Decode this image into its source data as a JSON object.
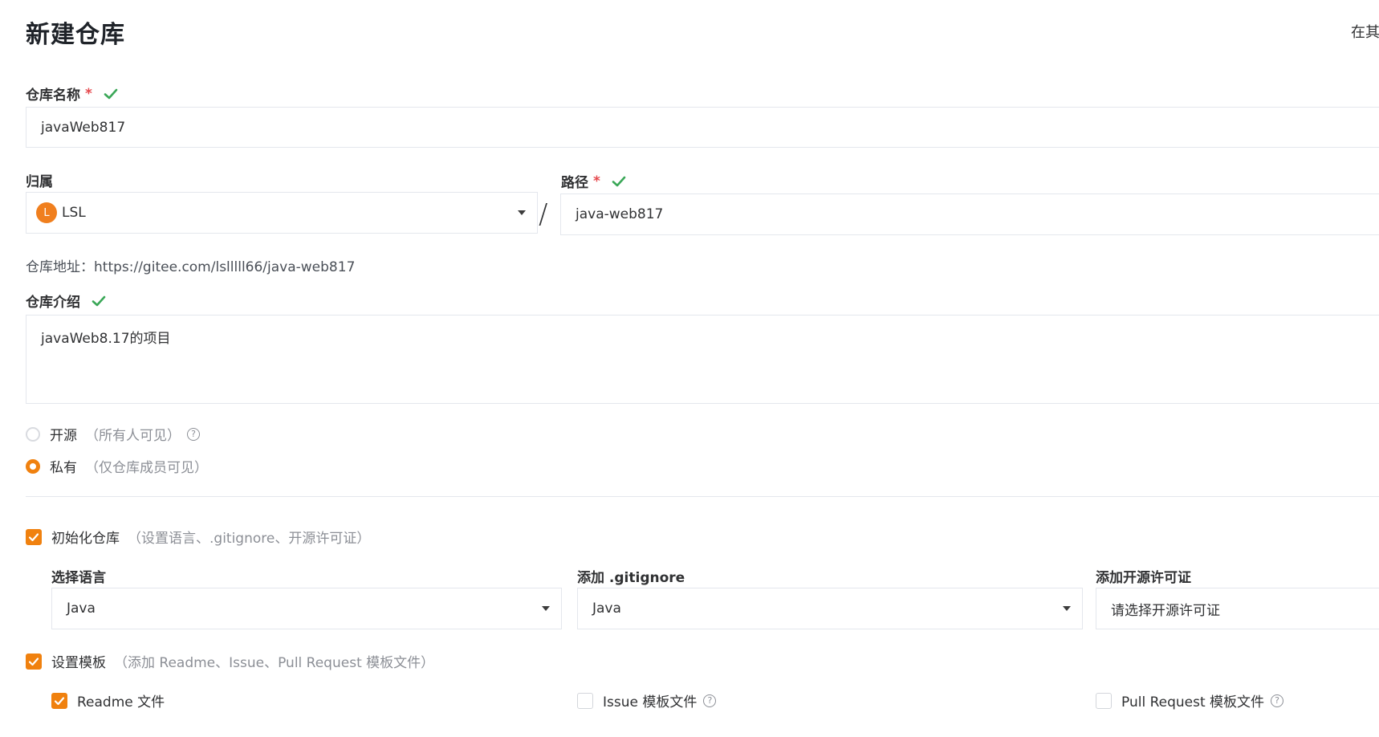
{
  "page": {
    "title": "新建仓库",
    "top_right_partial": "在其"
  },
  "repo_name": {
    "label": "仓库名称",
    "required_mark": "*",
    "value": "javaWeb817"
  },
  "owner": {
    "label": "归属",
    "avatar_letter": "L",
    "value": "LSL",
    "avatar_color": "#f07f1e"
  },
  "path": {
    "label": "路径",
    "required_mark": "*",
    "separator": "/",
    "value": "java-web817"
  },
  "repo_url": {
    "label": "仓库地址：",
    "value": "https://gitee.com/lslllll66/java-web817"
  },
  "description": {
    "label": "仓库介绍",
    "value": "javaWeb8.17的项目"
  },
  "visibility": {
    "public": {
      "label": "开源",
      "hint": "（所有人可见）",
      "selected": false
    },
    "private": {
      "label": "私有",
      "hint": "（仅仓库成员可见）",
      "selected": true
    }
  },
  "init": {
    "label": "初始化仓库",
    "hint": "（设置语言、.gitignore、开源许可证）",
    "checked": true,
    "language": {
      "label": "选择语言",
      "value": "Java"
    },
    "gitignore": {
      "label": "添加 .gitignore",
      "value": "Java"
    },
    "license": {
      "label": "添加开源许可证",
      "placeholder": "请选择开源许可证"
    }
  },
  "template": {
    "label": "设置模板",
    "hint": "（添加 Readme、Issue、Pull Request 模板文件）",
    "checked": true,
    "readme": {
      "label": "Readme 文件",
      "checked": true
    },
    "issue": {
      "label": "Issue 模板文件",
      "checked": false
    },
    "pr": {
      "label": "Pull Request 模板文件",
      "checked": false
    }
  },
  "colors": {
    "accent": "#f0810f",
    "success": "#3aa757",
    "required": "#e5484d"
  }
}
